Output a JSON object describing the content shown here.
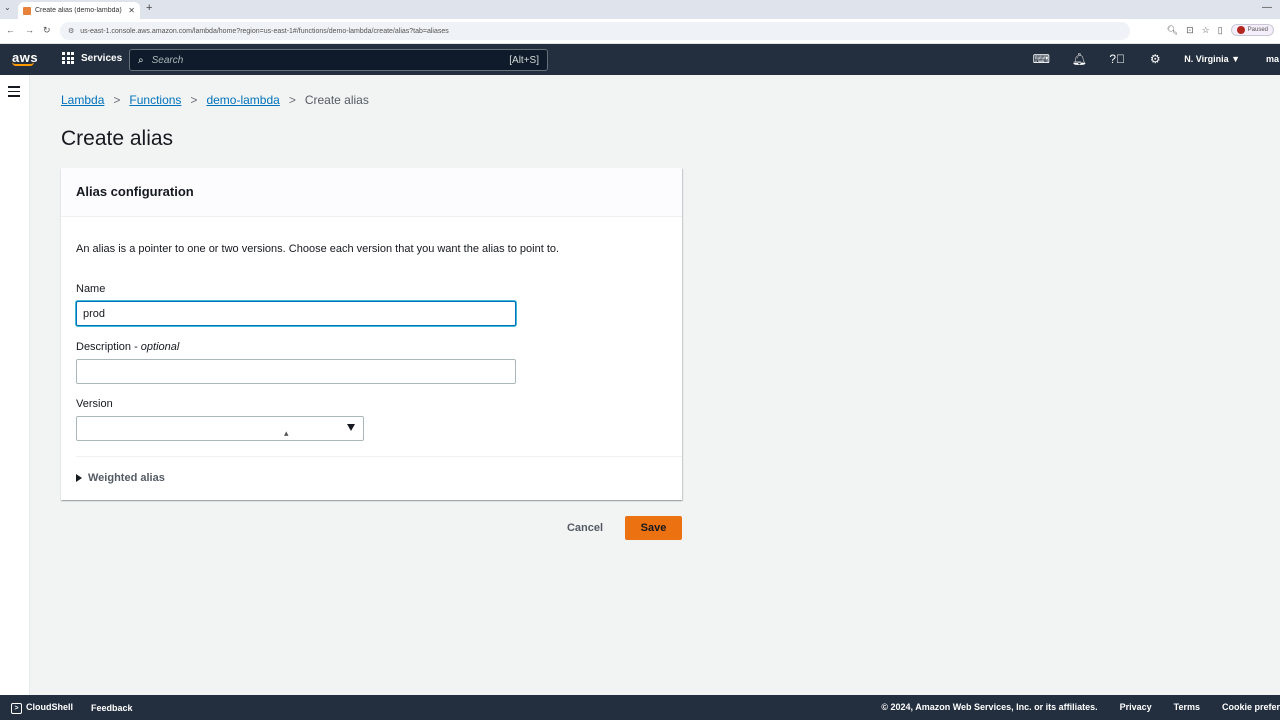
{
  "browser": {
    "tab_title": "Create alias (demo-lambda) - L",
    "url": "us-east-1.console.aws.amazon.com/lambda/home?region=us-east-1#/functions/demo-lambda/create/alias?tab=aliases",
    "profile_status": "Paused"
  },
  "nav": {
    "logo": "aws",
    "services_label": "Services",
    "search_placeholder": "Search",
    "search_shortcut": "[Alt+S]",
    "region": "N. Virginia ▼",
    "account": "ma"
  },
  "breadcrumb": [
    "Lambda",
    "Functions",
    "demo-lambda"
  ],
  "breadcrumb_current": "Create alias",
  "page_title": "Create alias",
  "panel": {
    "title": "Alias configuration",
    "description": "An alias is a pointer to one or two versions. Choose each version that you want the alias to point to.",
    "name_label": "Name",
    "name_value": "prod",
    "description_label": "Description - ",
    "description_optional": "optional",
    "description_value": "",
    "version_label": "Version",
    "version_value": "",
    "weighted_label": "Weighted alias"
  },
  "actions": {
    "cancel": "Cancel",
    "save": "Save"
  },
  "footer": {
    "cloudshell": "CloudShell",
    "feedback": "Feedback",
    "copyright": "© 2024, Amazon Web Services, Inc. or its affiliates.",
    "privacy": "Privacy",
    "terms": "Terms",
    "cookies": "Cookie preferences"
  }
}
